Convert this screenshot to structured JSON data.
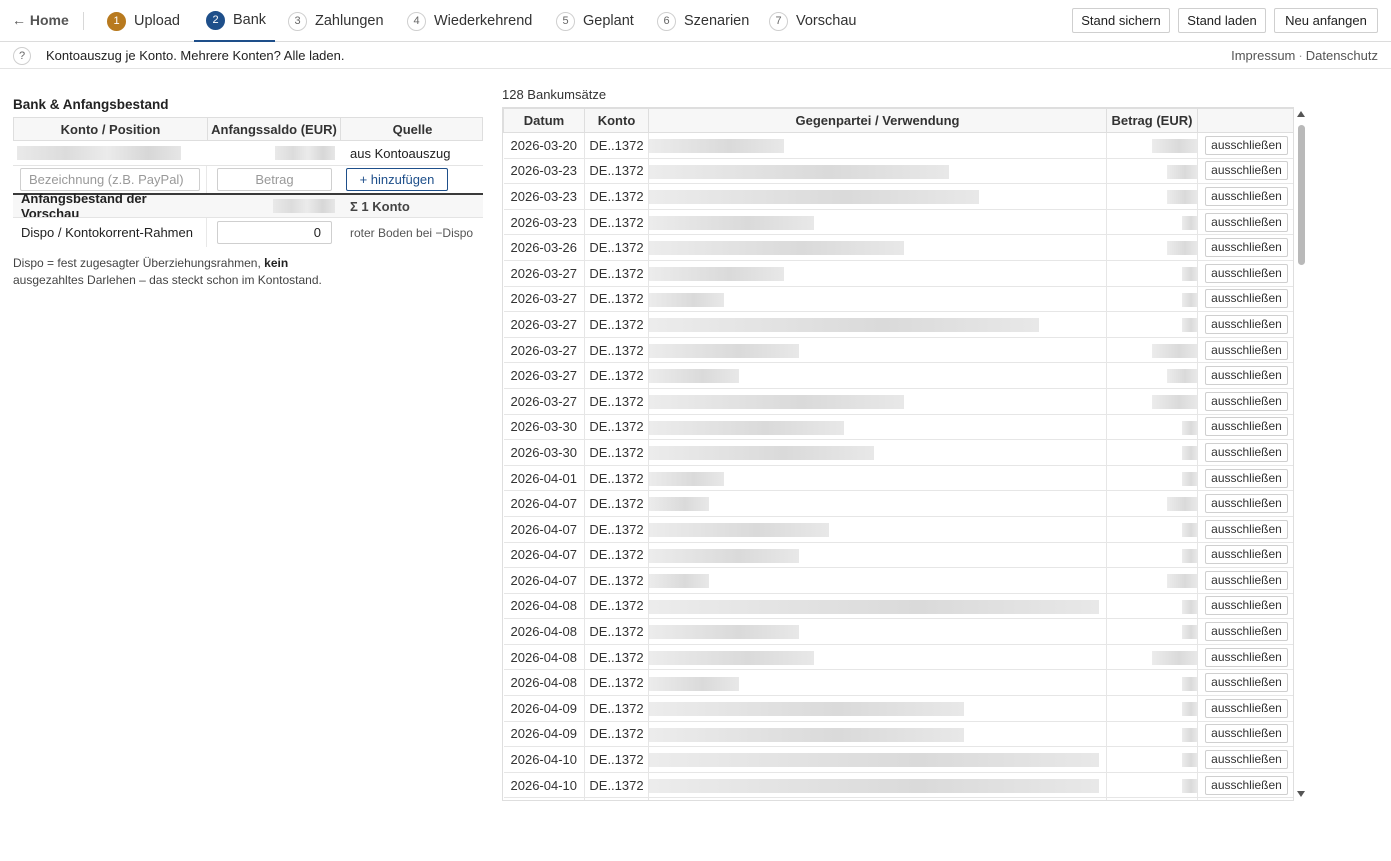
{
  "nav": {
    "home_label": "Home",
    "steps": [
      {
        "num": "1",
        "label": "Upload"
      },
      {
        "num": "2",
        "label": "Bank"
      },
      {
        "num": "3",
        "label": "Zahlungen"
      },
      {
        "num": "4",
        "label": "Wiederkehrend"
      },
      {
        "num": "5",
        "label": "Geplant"
      },
      {
        "num": "6",
        "label": "Szenarien"
      },
      {
        "num": "7",
        "label": "Vorschau"
      }
    ],
    "active_step": "2",
    "buttons": {
      "save": "Stand sichern",
      "load": "Stand laden",
      "reset": "Neu anfangen"
    }
  },
  "info": {
    "help_glyph": "?",
    "text": "Kontoauszug je Konto. Mehrere Konten? Alle laden.",
    "impressum": "Impressum",
    "separator": "·",
    "datenschutz": "Datenschutz"
  },
  "bank": {
    "title": "Bank & Anfangsbestand",
    "headers": [
      "Konto / Position",
      "Anfangssaldo (EUR)",
      "Quelle"
    ],
    "account_row": {
      "source": "aus Kontoauszug"
    },
    "add_row": {
      "name_placeholder": "Bezeichnung (z.B. PayPal)",
      "amount_placeholder": "Betrag",
      "add_label": "+ hinzufügen"
    },
    "sum_row": {
      "label": "Anfangsbestand der Vorschau",
      "summary": "Σ 1 Konto"
    },
    "dispo_row": {
      "label": "Dispo / Kontokorrent-Rahmen",
      "value": "0",
      "hint": "roter Boden bei −Dispo"
    },
    "note_part1": "Dispo = fest zugesagter Überziehungsrahmen, ",
    "note_bold": "kein",
    "note_part2": " ausgezahltes Darlehen – das steckt schon im Kontostand."
  },
  "transactions": {
    "count_label": "128 Bankumsätze",
    "headers": [
      "Datum",
      "Konto",
      "Gegenpartei / Verwendung",
      "Betrag (EUR)",
      ""
    ],
    "exclude_label": "ausschließen",
    "rows": [
      {
        "date": "2026-03-20",
        "account": "DE..1372"
      },
      {
        "date": "2026-03-23",
        "account": "DE..1372"
      },
      {
        "date": "2026-03-23",
        "account": "DE..1372"
      },
      {
        "date": "2026-03-23",
        "account": "DE..1372"
      },
      {
        "date": "2026-03-26",
        "account": "DE..1372"
      },
      {
        "date": "2026-03-27",
        "account": "DE..1372"
      },
      {
        "date": "2026-03-27",
        "account": "DE..1372"
      },
      {
        "date": "2026-03-27",
        "account": "DE..1372"
      },
      {
        "date": "2026-03-27",
        "account": "DE..1372"
      },
      {
        "date": "2026-03-27",
        "account": "DE..1372"
      },
      {
        "date": "2026-03-27",
        "account": "DE..1372"
      },
      {
        "date": "2026-03-30",
        "account": "DE..1372"
      },
      {
        "date": "2026-03-30",
        "account": "DE..1372"
      },
      {
        "date": "2026-04-01",
        "account": "DE..1372"
      },
      {
        "date": "2026-04-07",
        "account": "DE..1372"
      },
      {
        "date": "2026-04-07",
        "account": "DE..1372"
      },
      {
        "date": "2026-04-07",
        "account": "DE..1372"
      },
      {
        "date": "2026-04-07",
        "account": "DE..1372"
      },
      {
        "date": "2026-04-08",
        "account": "DE..1372"
      },
      {
        "date": "2026-04-08",
        "account": "DE..1372"
      },
      {
        "date": "2026-04-08",
        "account": "DE..1372"
      },
      {
        "date": "2026-04-08",
        "account": "DE..1372"
      },
      {
        "date": "2026-04-09",
        "account": "DE..1372"
      },
      {
        "date": "2026-04-09",
        "account": "DE..1372"
      },
      {
        "date": "2026-04-10",
        "account": "DE..1372"
      },
      {
        "date": "2026-04-10",
        "account": "DE..1372"
      },
      {
        "date": "",
        "account": ""
      }
    ]
  }
}
